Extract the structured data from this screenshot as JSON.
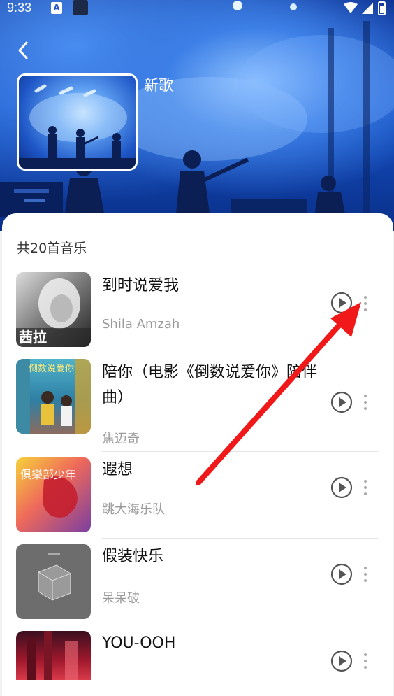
{
  "status_bar": {
    "time": "9:33",
    "a_badge": "A"
  },
  "header": {
    "back_icon": "chevron-left-icon",
    "playlist_title": "新歌"
  },
  "list": {
    "count_label": "共20首音乐",
    "songs": [
      {
        "title": "到时说爱我",
        "artist": "Shila Amzah",
        "art_text": "茜拉"
      },
      {
        "title": "陪你（电影《倒数说爱你》陪伴曲）",
        "artist": "焦迈奇",
        "art_text": "倒数说爱你"
      },
      {
        "title": "遐想",
        "artist": "跳大海乐队",
        "art_text": "俱樂部少年"
      },
      {
        "title": "假装快乐",
        "artist": "呆呆破",
        "art_text": ""
      },
      {
        "title": "YOU-OOH",
        "artist": "",
        "art_text": ""
      }
    ]
  },
  "colors": {
    "hero_blue": "#1552c7",
    "arrow_red": "#f01818",
    "artist_gray": "#9a9a9a"
  }
}
